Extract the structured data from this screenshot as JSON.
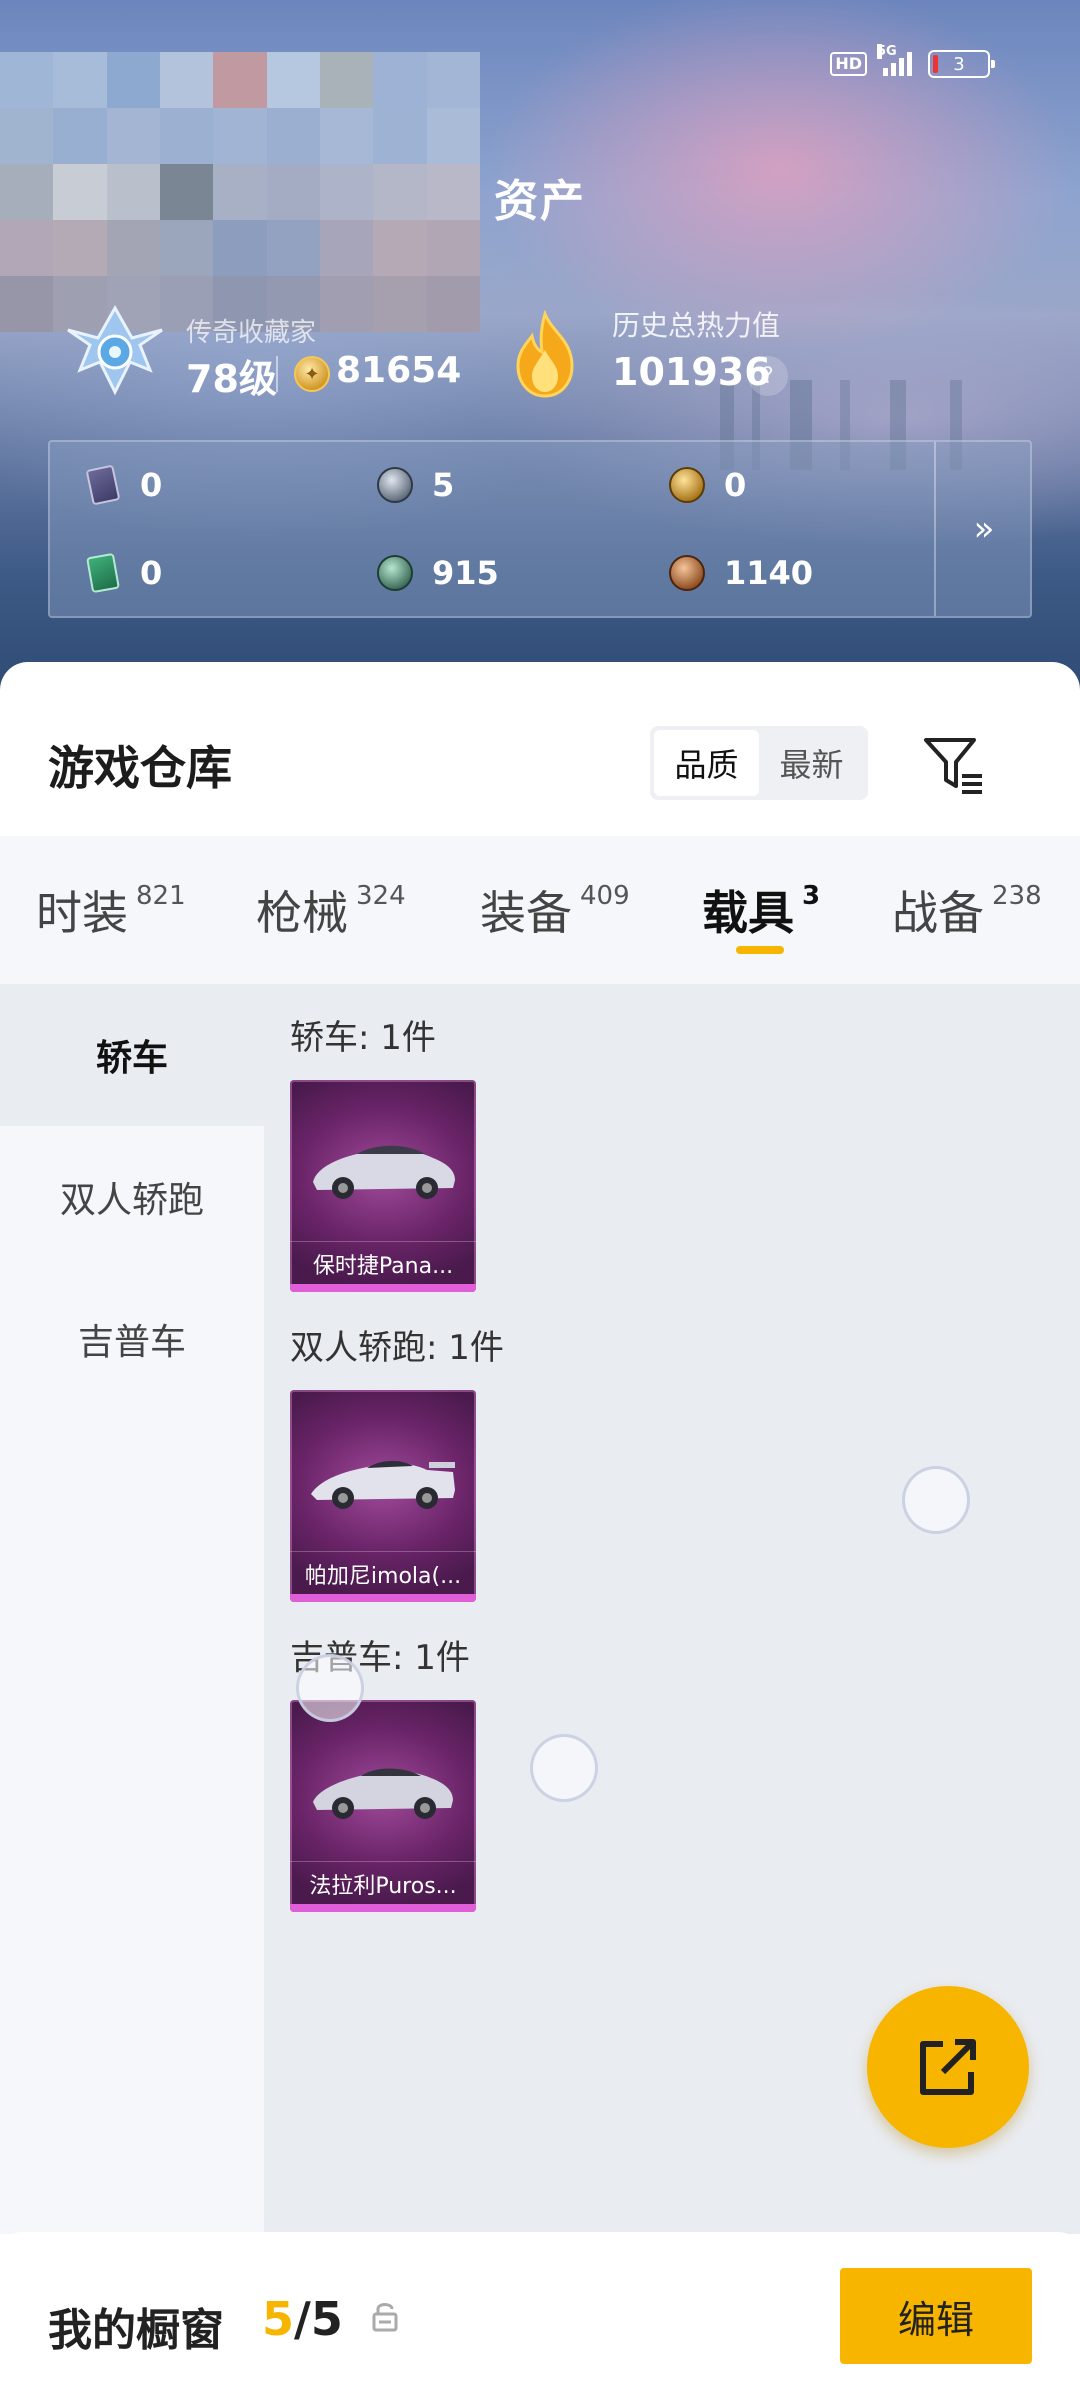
{
  "status_bar": {
    "network": "5G",
    "hd": "HD",
    "battery": "3"
  },
  "header": {
    "title": "资产"
  },
  "profile": {
    "rank_label": "传奇收藏家",
    "level": "78级",
    "coins": "81654",
    "heat_label": "历史总热力值",
    "heat_value": "101936",
    "help": "?"
  },
  "currencies": [
    {
      "icon": "purple-card-icon",
      "value": "0"
    },
    {
      "icon": "silver-coin-icon",
      "value": "5"
    },
    {
      "icon": "gold-coin-icon",
      "value": "0"
    },
    {
      "icon": "green-card-icon",
      "value": "0"
    },
    {
      "icon": "green-coin-icon",
      "value": "915"
    },
    {
      "icon": "bronze-coin-icon",
      "value": "1140"
    }
  ],
  "warehouse": {
    "title": "游戏仓库",
    "sort": {
      "options": [
        "品质",
        "最新"
      ],
      "selected": "品质"
    }
  },
  "tabs": [
    {
      "label": "时装",
      "count": "821"
    },
    {
      "label": "枪械",
      "count": "324"
    },
    {
      "label": "装备",
      "count": "409"
    },
    {
      "label": "载具",
      "count": "3",
      "active": true
    },
    {
      "label": "战备",
      "count": "238"
    }
  ],
  "sidebar": {
    "items": [
      {
        "label": "轿车",
        "active": true
      },
      {
        "label": "双人轿跑"
      },
      {
        "label": "吉普车"
      }
    ]
  },
  "groups": [
    {
      "title": "轿车: 1件",
      "items": [
        {
          "name": "保时捷Pana..."
        }
      ]
    },
    {
      "title": "双人轿跑: 1件",
      "items": [
        {
          "name": "帕加尼imola(..."
        }
      ]
    },
    {
      "title": "吉普车: 1件",
      "items": [
        {
          "name": "法拉利Puros..."
        }
      ]
    }
  ],
  "showcase": {
    "title": "我的橱窗",
    "used": "5",
    "separator": "/",
    "total": "5",
    "edit_label": "编辑"
  },
  "colors": {
    "accent": "#f7b500",
    "card_purple": "#6a2468",
    "card_pink": "#e05ed8"
  }
}
